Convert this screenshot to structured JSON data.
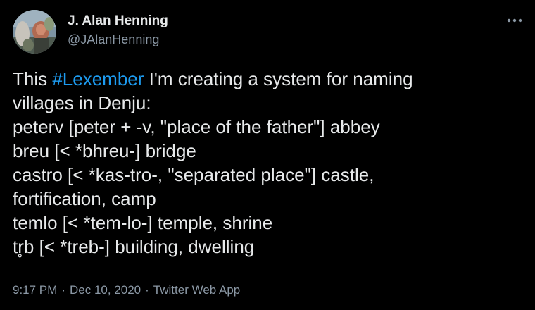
{
  "author": {
    "display_name": "J. Alan Henning",
    "handle": "@JAlanHenning"
  },
  "more_icon": "more-horizontal-icon",
  "tweet": {
    "intro_prefix": "This ",
    "hashtag": "#Lexember",
    "intro_suffix": " I'm creating a system for naming",
    "lines": [
      "villages in Denju:",
      "peterv [peter + -v, \"place of the father\"] abbey",
      "breu [< *bhreu-] bridge",
      "castro [< *kas-tro-, \"separated place\"] castle,",
      "fortification, camp",
      "temlo [< *tem-lo-] temple, shrine",
      "tr̥b [< *treb-] building, dwelling"
    ]
  },
  "meta": {
    "time": "9:17 PM",
    "separator": "·",
    "date": "Dec 10, 2020",
    "source": "Twitter Web App"
  },
  "colors": {
    "background": "#000000",
    "text": "#e7e9ea",
    "secondary": "#8b98a5",
    "link": "#1d9bf0"
  }
}
